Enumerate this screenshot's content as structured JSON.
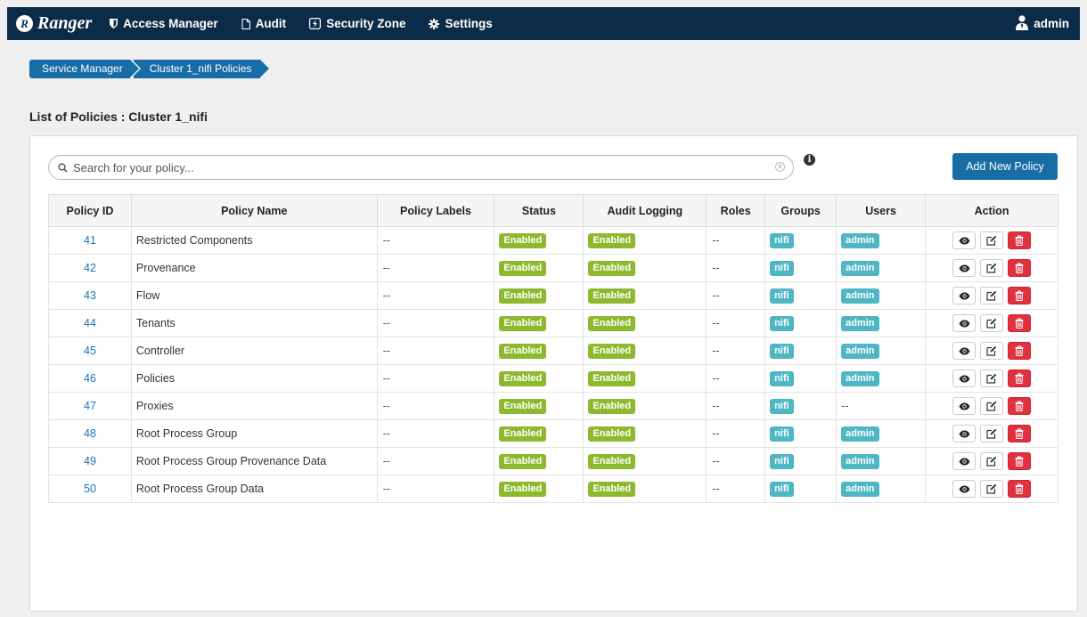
{
  "nav": {
    "brand": "Ranger",
    "brand_logo": "R",
    "items": [
      {
        "label": "Access Manager",
        "icon": "shield-icon"
      },
      {
        "label": "Audit",
        "icon": "file-icon"
      },
      {
        "label": "Security Zone",
        "icon": "zone-icon"
      },
      {
        "label": "Settings",
        "icon": "gear-icon"
      }
    ],
    "user": "admin"
  },
  "breadcrumb": [
    "Service Manager",
    "Cluster 1_nifi Policies"
  ],
  "page_title": "List of Policies : Cluster 1_nifi",
  "search": {
    "placeholder": "Search for your policy...",
    "value": ""
  },
  "add_button": "Add New Policy",
  "columns": [
    "Policy ID",
    "Policy Name",
    "Policy Labels",
    "Status",
    "Audit Logging",
    "Roles",
    "Groups",
    "Users",
    "Action"
  ],
  "rows": [
    {
      "id": "41",
      "name": "Restricted Components",
      "labels": "--",
      "status": "Enabled",
      "audit": "Enabled",
      "roles": "--",
      "groups": "nifi",
      "users": "admin"
    },
    {
      "id": "42",
      "name": "Provenance",
      "labels": "--",
      "status": "Enabled",
      "audit": "Enabled",
      "roles": "--",
      "groups": "nifi",
      "users": "admin"
    },
    {
      "id": "43",
      "name": "Flow",
      "labels": "--",
      "status": "Enabled",
      "audit": "Enabled",
      "roles": "--",
      "groups": "nifi",
      "users": "admin"
    },
    {
      "id": "44",
      "name": "Tenants",
      "labels": "--",
      "status": "Enabled",
      "audit": "Enabled",
      "roles": "--",
      "groups": "nifi",
      "users": "admin"
    },
    {
      "id": "45",
      "name": "Controller",
      "labels": "--",
      "status": "Enabled",
      "audit": "Enabled",
      "roles": "--",
      "groups": "nifi",
      "users": "admin"
    },
    {
      "id": "46",
      "name": "Policies",
      "labels": "--",
      "status": "Enabled",
      "audit": "Enabled",
      "roles": "--",
      "groups": "nifi",
      "users": "admin"
    },
    {
      "id": "47",
      "name": "Proxies",
      "labels": "--",
      "status": "Enabled",
      "audit": "Enabled",
      "roles": "--",
      "groups": "nifi",
      "users": "--"
    },
    {
      "id": "48",
      "name": "Root Process Group",
      "labels": "--",
      "status": "Enabled",
      "audit": "Enabled",
      "roles": "--",
      "groups": "nifi",
      "users": "admin"
    },
    {
      "id": "49",
      "name": "Root Process Group Provenance Data",
      "labels": "--",
      "status": "Enabled",
      "audit": "Enabled",
      "roles": "--",
      "groups": "nifi",
      "users": "admin"
    },
    {
      "id": "50",
      "name": "Root Process Group Data",
      "labels": "--",
      "status": "Enabled",
      "audit": "Enabled",
      "roles": "--",
      "groups": "nifi",
      "users": "admin"
    }
  ],
  "colors": {
    "nav_bg": "#0c2b49",
    "primary": "#196da6",
    "enabled": "#8db92e",
    "tag": "#4fb6c4",
    "delete": "#e0313f"
  }
}
